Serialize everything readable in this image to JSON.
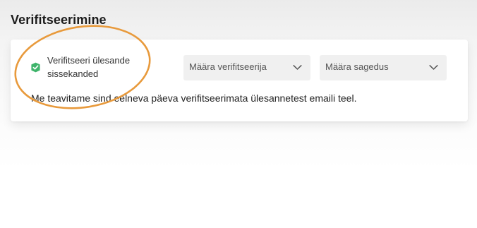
{
  "section": {
    "title": "Verifitseerimine"
  },
  "verification": {
    "checkbox_label": "Verifitseeri ülesande sissekanded",
    "checked": true,
    "info_text": "Me teavitame sind eelneva päeva verifitseerimata ülesannetest emaili teel."
  },
  "selects": {
    "verifier_placeholder": "Määra verifitseerija",
    "frequency_placeholder": "Määra sagedus"
  },
  "icons": {
    "check": "check-badge-icon",
    "dropdown": "chevron-down-icon"
  },
  "colors": {
    "check_green": "#3fb46b",
    "annotation_orange": "#e89a3c",
    "select_bg": "#f0f0f0"
  }
}
